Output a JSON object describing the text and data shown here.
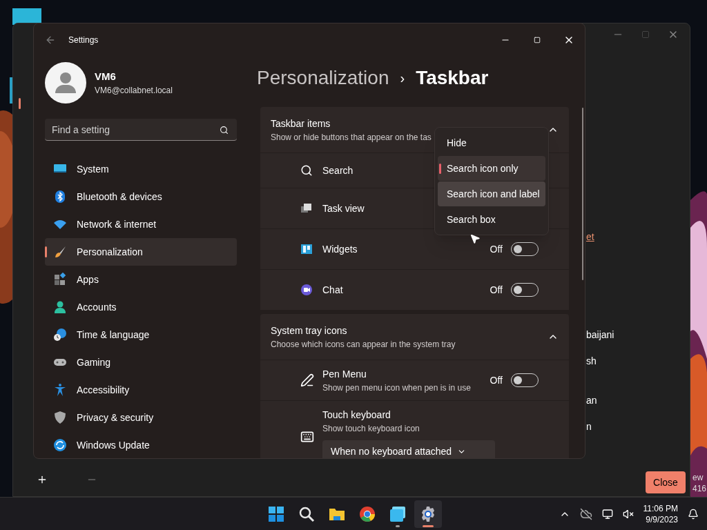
{
  "desktop": {
    "corner_text": [
      "ew",
      "416"
    ]
  },
  "background_window": {
    "fragments": [
      {
        "text": "et",
        "kind": "link"
      },
      {
        "text": "baijani",
        "kind": "text"
      },
      {
        "text": "sh",
        "kind": "text"
      },
      {
        "text": "an",
        "kind": "text"
      },
      {
        "text": "n",
        "kind": "text"
      }
    ],
    "close_button": "Close"
  },
  "window": {
    "title": "Settings"
  },
  "profile": {
    "name": "VM6",
    "email": "VM6@collabnet.local"
  },
  "search": {
    "placeholder": "Find a setting"
  },
  "sidebar": {
    "items": [
      {
        "label": "System",
        "selected": false
      },
      {
        "label": "Bluetooth & devices",
        "selected": false
      },
      {
        "label": "Network & internet",
        "selected": false
      },
      {
        "label": "Personalization",
        "selected": true
      },
      {
        "label": "Apps",
        "selected": false
      },
      {
        "label": "Accounts",
        "selected": false
      },
      {
        "label": "Time & language",
        "selected": false
      },
      {
        "label": "Gaming",
        "selected": false
      },
      {
        "label": "Accessibility",
        "selected": false
      },
      {
        "label": "Privacy & security",
        "selected": false
      },
      {
        "label": "Windows Update",
        "selected": false
      }
    ]
  },
  "breadcrumb": {
    "parent": "Personalization",
    "separator": "›",
    "current": "Taskbar"
  },
  "sections": [
    {
      "title": "Taskbar items",
      "subtitle": "Show or hide buttons that appear on the tas",
      "expanded": true,
      "rows": [
        {
          "kind": "plain",
          "label": "Search"
        },
        {
          "kind": "plain",
          "label": "Task view"
        },
        {
          "kind": "toggle",
          "label": "Widgets",
          "state_text": "Off",
          "on": false
        },
        {
          "kind": "toggle",
          "label": "Chat",
          "state_text": "Off",
          "on": false
        }
      ]
    },
    {
      "title": "System tray icons",
      "subtitle": "Choose which icons can appear in the system tray",
      "expanded": true,
      "rows": [
        {
          "kind": "toggle",
          "label": "Pen Menu",
          "description": "Show pen menu icon when pen is in use",
          "state_text": "Off",
          "on": false
        },
        {
          "kind": "dropdown",
          "label": "Touch keyboard",
          "description": "Show touch keyboard icon",
          "value": "When no keyboard attached"
        }
      ]
    }
  ],
  "search_menu": {
    "options": [
      {
        "label": "Hide",
        "selected": false,
        "hovered": false
      },
      {
        "label": "Search icon only",
        "selected": true,
        "hovered": false
      },
      {
        "label": "Search icon and label",
        "selected": false,
        "hovered": true
      },
      {
        "label": "Search box",
        "selected": false,
        "hovered": false
      }
    ]
  },
  "taskbar": {
    "apps": [
      {
        "running": false,
        "active": false
      },
      {
        "running": false,
        "active": false
      },
      {
        "running": false,
        "active": false
      },
      {
        "running": false,
        "active": false
      },
      {
        "running": true,
        "active": false
      },
      {
        "running": true,
        "active": true
      }
    ],
    "time": "11:06 PM",
    "date": "9/9/2023"
  }
}
